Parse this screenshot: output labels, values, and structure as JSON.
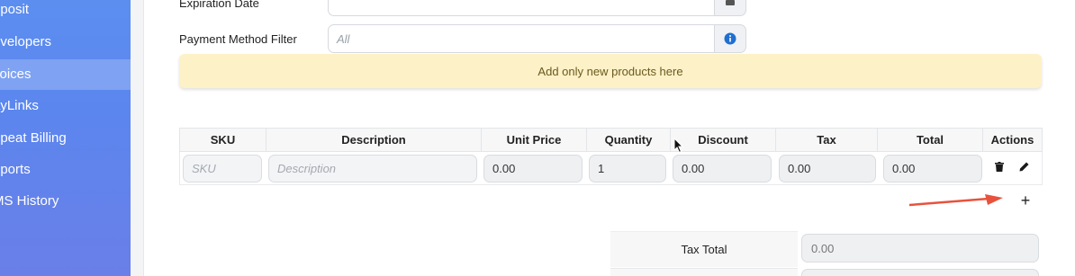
{
  "sidebar": {
    "items": [
      {
        "label": "eposit",
        "active": false
      },
      {
        "label": "evelopers",
        "active": false
      },
      {
        "label": "voices",
        "active": true
      },
      {
        "label": "ayLinks",
        "active": false
      },
      {
        "label": "epeat Billing",
        "active": false
      },
      {
        "label": "eports",
        "active": false
      },
      {
        "label": "MS History",
        "active": false
      }
    ]
  },
  "form": {
    "expiration_date_label": "Expiration Date",
    "payment_method_filter_label": "Payment Method Filter",
    "payment_method_filter_placeholder": "All",
    "calendar_icon": "calendar-icon",
    "info_icon": "info-icon"
  },
  "notice": {
    "text": "Add only new products here"
  },
  "table": {
    "headers": [
      "SKU",
      "Description",
      "Unit Price",
      "Quantity",
      "Discount",
      "Tax",
      "Total",
      "Actions"
    ],
    "row": {
      "sku_placeholder": "SKU",
      "description_placeholder": "Description",
      "unit_price": "0.00",
      "quantity": "1",
      "discount": "0.00",
      "tax": "0.00",
      "total": "0.00"
    },
    "add_row_symbol": "+"
  },
  "totals": {
    "tax_total_label": "Tax Total",
    "tax_total_value": "0.00"
  },
  "colors": {
    "sidebar_top": "#5c8ef0",
    "sidebar_bottom": "#6a7fe8",
    "notice_bg": "#fdf1c8",
    "info_icon": "#1f6fd1",
    "annotation_arrow": "#e8523c"
  }
}
